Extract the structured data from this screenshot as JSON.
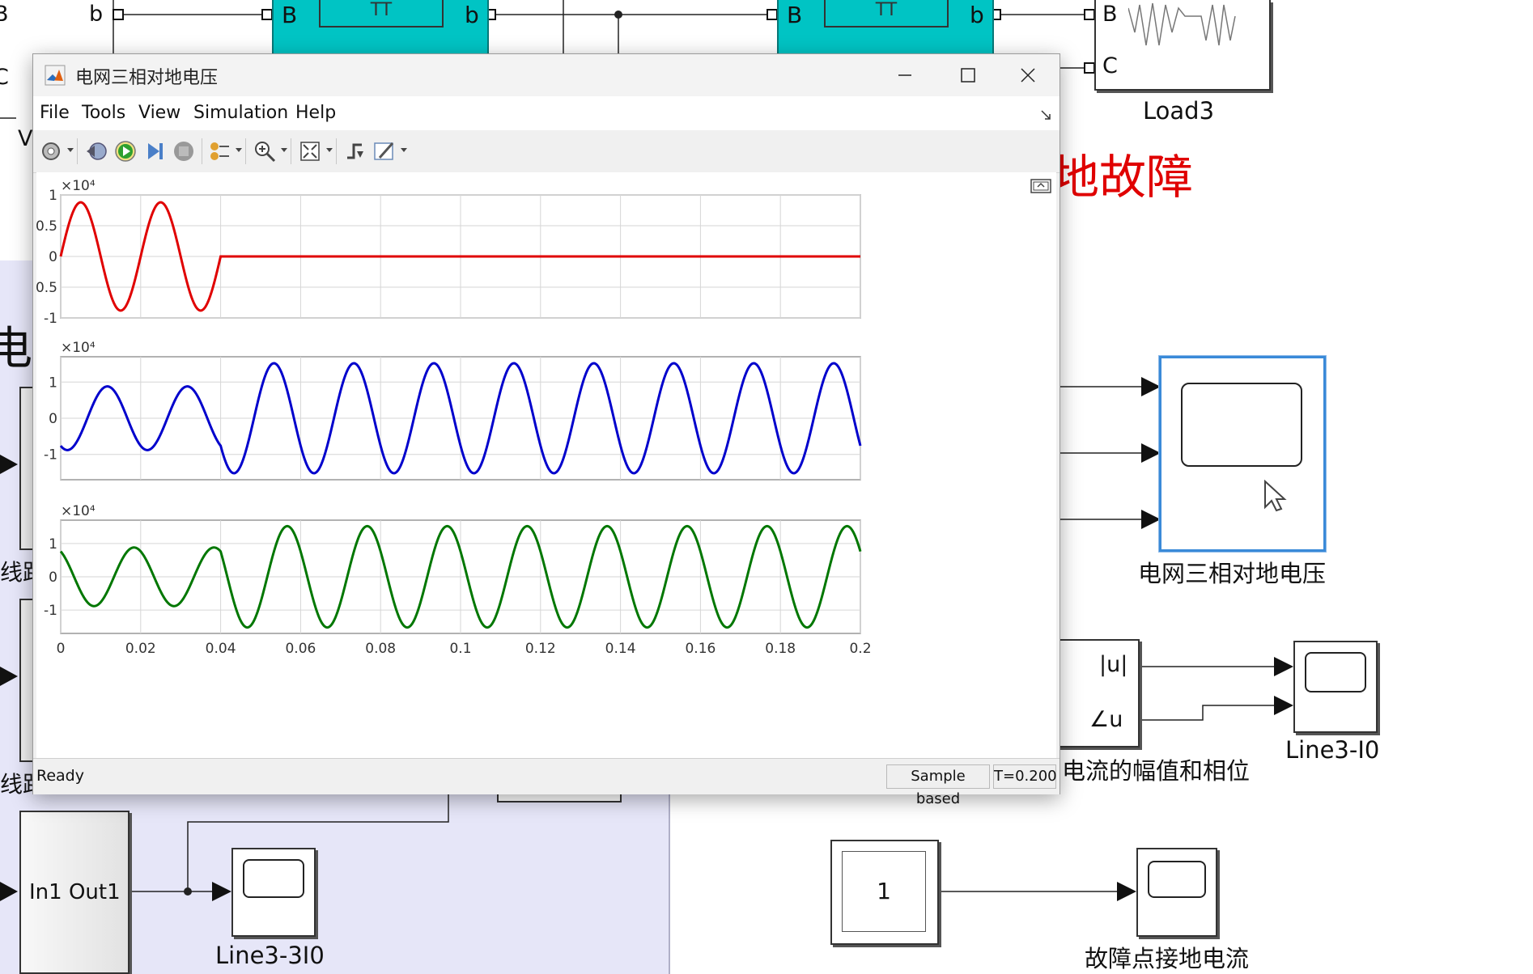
{
  "canvas": {
    "left_ports": [
      "B",
      "C"
    ],
    "line_b_labels": [
      "b",
      "b"
    ],
    "block_B_label": "B",
    "pi_section_label": "TT",
    "load3_ports": [
      "B",
      "C"
    ],
    "load3_label": "Load3",
    "red_title_fragment": "地故障",
    "left_partial_char": "V",
    "left_cn_fragment": "电流",
    "left_cn_line1": "线路",
    "left_cn_line2": "线路",
    "selected_scope_label": "电网三相对地电压",
    "fourier_ports": [
      "|u|",
      "∠u"
    ],
    "fourier_caption": "电流的幅值和相位",
    "scope_line3_i0_label": "Line3-I0",
    "subsystem_label": "In1 Out1",
    "scope_line3_3i0_label": "Line3-3I0",
    "constant_value": "1",
    "scope_fault_label": "故障点接地电流"
  },
  "scope_window": {
    "title": "电网三相对地电压",
    "menu": [
      "File",
      "Tools",
      "View",
      "Simulation",
      "Help"
    ],
    "toolbar_icons": [
      "configuration-icon",
      "step-back-icon",
      "run-icon",
      "step-forward-icon",
      "stop-icon",
      "signal-style-icon",
      "zoom-icon",
      "autoscale-icon",
      "triggers-icon",
      "measurements-icon"
    ],
    "status": "Ready",
    "sample_mode": "Sample based",
    "time": "T=0.200"
  },
  "chart_data": [
    {
      "type": "line",
      "title": "",
      "x": [
        0,
        0.02,
        0.04,
        0.06,
        0.08,
        0.1,
        0.12,
        0.14,
        0.16,
        0.18,
        0.2
      ],
      "xlim": [
        0,
        0.2
      ],
      "ylim": [
        -1,
        1
      ],
      "yticks": [
        "1",
        "0.5",
        "0",
        "-0.5",
        "-1"
      ],
      "exponent": "×10⁴",
      "color": "#e00000",
      "series": [
        {
          "pre_fault": {
            "t_end": 0.04,
            "amplitude": 0.88,
            "freq_hz": 50,
            "phase_deg": 0
          },
          "post_fault": {
            "t_start": 0.04,
            "value": 0
          }
        }
      ]
    },
    {
      "type": "line",
      "title": "",
      "xlim": [
        0,
        0.2
      ],
      "ylim": [
        -1.7,
        1.7
      ],
      "yticks": [
        "1",
        "0",
        "-1"
      ],
      "exponent": "×10⁴",
      "color": "#0000cc",
      "series": [
        {
          "pre_fault": {
            "t_end": 0.04,
            "amplitude": 0.88,
            "freq_hz": 50,
            "phase_deg": -120
          },
          "post_fault": {
            "t_start": 0.04,
            "amplitude": 1.52,
            "freq_hz": 50,
            "phase_deg": -150
          }
        }
      ]
    },
    {
      "type": "line",
      "title": "",
      "xlim": [
        0,
        0.2
      ],
      "ylim": [
        -1.7,
        1.7
      ],
      "yticks": [
        "1",
        "0",
        "-1"
      ],
      "exponent": "×10⁴",
      "color": "#007700",
      "xticks": [
        "0",
        "0.02",
        "0.04",
        "0.06",
        "0.08",
        "0.1",
        "0.12",
        "0.14",
        "0.16",
        "0.18",
        "0.2"
      ],
      "series": [
        {
          "pre_fault": {
            "t_end": 0.04,
            "amplitude": 0.88,
            "freq_hz": 50,
            "phase_deg": 120
          },
          "post_fault": {
            "t_start": 0.04,
            "amplitude": 1.52,
            "freq_hz": 50,
            "phase_deg": 150
          }
        }
      ]
    }
  ],
  "colors": {
    "pi_block": "#00c4c4",
    "subsystem_bg": "#e6e6f8",
    "red_text": "#e00000",
    "selection": "#3a8ad8"
  }
}
